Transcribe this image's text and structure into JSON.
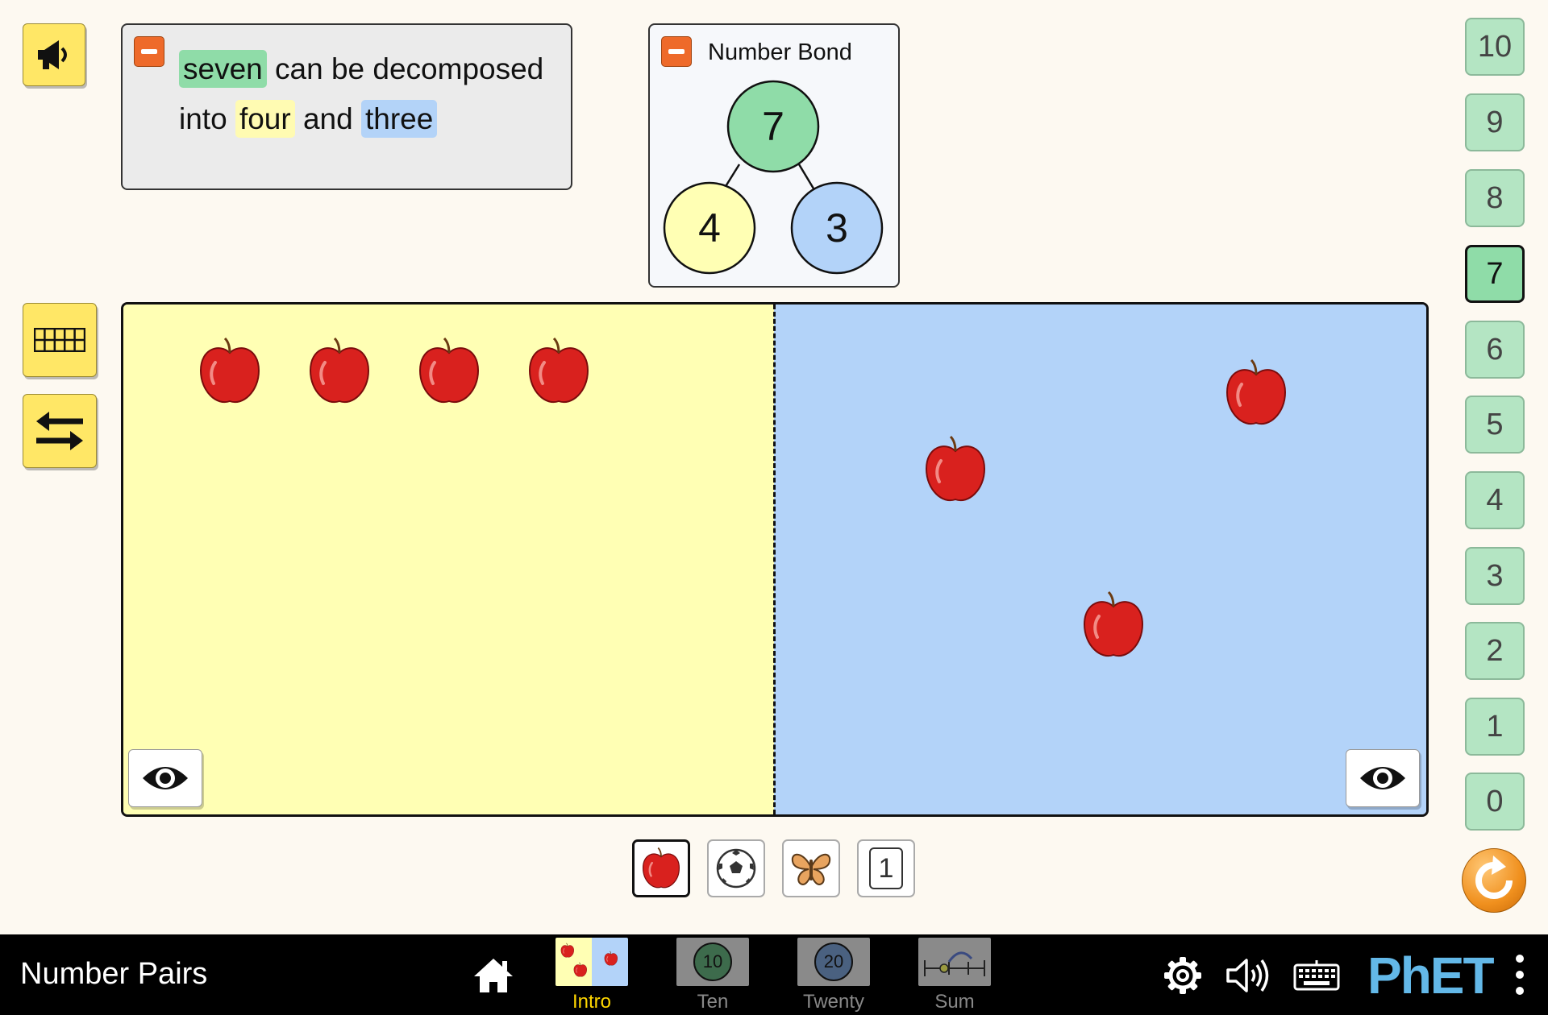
{
  "sentence": {
    "total": "seven",
    "part1": "can be decomposed",
    "part2": "into",
    "left": "four",
    "part3": "and",
    "right": "three"
  },
  "number_bond": {
    "title": "Number Bond",
    "total": "7",
    "left": "4",
    "right": "3"
  },
  "number_buttons": [
    "10",
    "9",
    "8",
    "7",
    "6",
    "5",
    "4",
    "3",
    "2",
    "1",
    "0"
  ],
  "selected_number": "7",
  "representations": {
    "number_card": "1"
  },
  "navbar": {
    "title": "Number Pairs",
    "screens": [
      {
        "label": "Intro",
        "icon_text": ""
      },
      {
        "label": "Ten",
        "icon_text": "10"
      },
      {
        "label": "Twenty",
        "icon_text": "20"
      },
      {
        "label": "Sum",
        "icon_text": ""
      }
    ],
    "brand": "PhET"
  },
  "colors": {
    "total": "#8fdca8",
    "left": "#ffffb4",
    "right": "#b3d3f9",
    "accent_orange": "#ee6a2a",
    "tool_yellow": "#ffe766"
  }
}
